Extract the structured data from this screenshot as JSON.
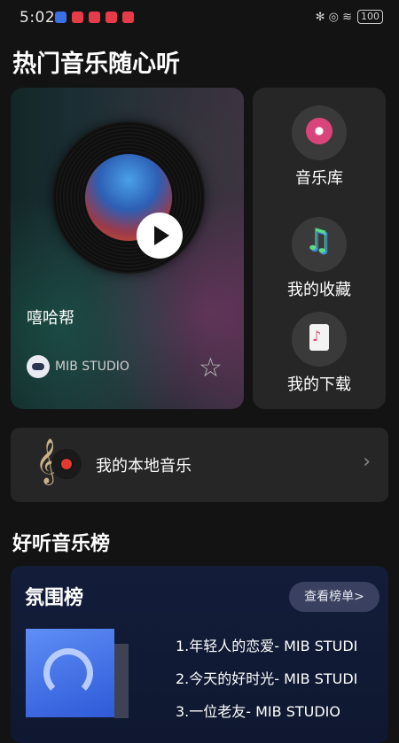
{
  "status": {
    "time": "5:02",
    "signal_text": "✻ ◎ ≋",
    "battery": "100"
  },
  "page": {
    "heading": "热门音乐随心听"
  },
  "featured": {
    "name": "嘻哈帮",
    "studio": "MIB STUDIO"
  },
  "side_menu": [
    {
      "label": "音乐库",
      "icon": "music-library-icon"
    },
    {
      "label": "我的收藏",
      "icon": "music-favorites-icon"
    },
    {
      "label": "我的下载",
      "icon": "music-download-icon"
    }
  ],
  "local_music": {
    "label": "我的本地音乐"
  },
  "charts_section": {
    "heading": "好听音乐榜",
    "card_title": "氛围榜",
    "view_button": "查看榜单>",
    "songs": [
      "1.年轻人的恋爱- MIB STUDI",
      "2.今天的好时光- MIB STUDI",
      "3.一位老友- MIB STUDIO"
    ]
  },
  "colors": {
    "background": "#131313",
    "card": "#262626",
    "chart_card": "#131d3a",
    "view_button": "#3a4160"
  }
}
